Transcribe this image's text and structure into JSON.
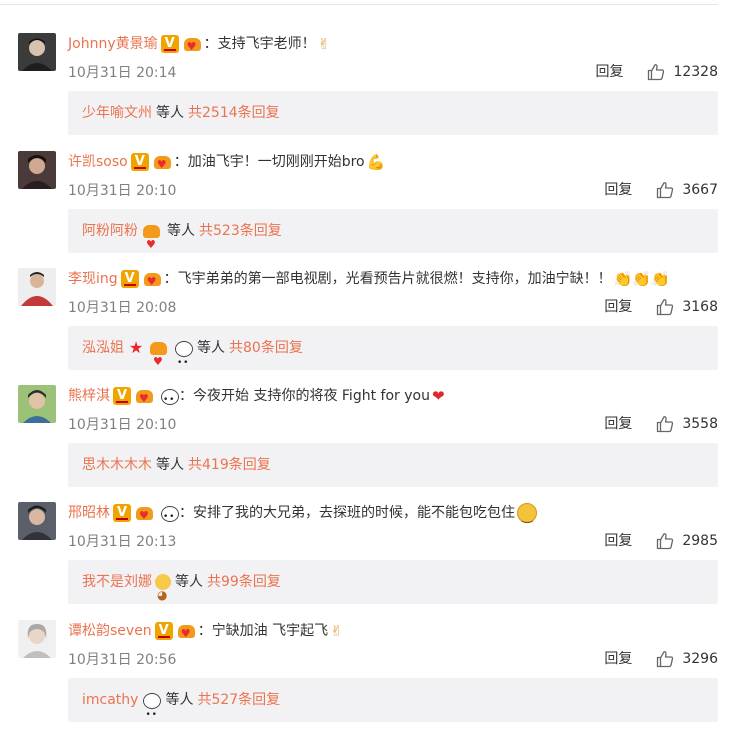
{
  "reply_label": "回复",
  "deng_ren": "等人",
  "comments": [
    {
      "user": "Johnny黄景瑜",
      "text": "支持飞宇老师！",
      "time": "10月31日 20:14",
      "likes": "12328",
      "sub_user": "少年喻文州",
      "sub_total": "共2514条回复",
      "avatar_color": "#3b3b3b",
      "emoji": "hand-icon"
    },
    {
      "user": "许凯soso",
      "text": "加油飞宇！一切刚刚开始bro",
      "time": "10月31日 20:10",
      "likes": "3667",
      "sub_user": "阿粉阿粉",
      "sub_total": "共523条回复",
      "avatar_color": "#4a3a3a",
      "emoji": "muscle-icon"
    },
    {
      "user": "李现ing",
      "text": "飞宇弟弟的第一部电视剧，光看预告片就很燃！支持你，加油宁缺！！",
      "time": "10月31日 20:08",
      "likes": "3168",
      "sub_user": "泓泓姐",
      "sub_total": "共80条回复",
      "avatar_color": "#c23a3a",
      "emoji": "clap-icon"
    },
    {
      "user": "熊梓淇",
      "text": "今夜开始 支持你的将夜 Fight for you",
      "time": "10月31日 20:10",
      "likes": "3558",
      "sub_user": "思木木木木",
      "sub_total": "共419条回复",
      "avatar_color": "#7aa35a",
      "emoji": "heart-icon"
    },
    {
      "user": "邢昭林",
      "text": "安排了我的大兄弟，去探班的时候，能不能包吃包住",
      "time": "10月31日 20:13",
      "likes": "2985",
      "sub_user": "我不是刘娜",
      "sub_total": "共99条回复",
      "avatar_color": "#5a5f6a",
      "emoji": "smile-icon"
    },
    {
      "user": "谭松韵seven",
      "text": "宁缺加油 飞宇起飞",
      "time": "10月31日 20:56",
      "likes": "3296",
      "sub_user": "imcathy",
      "sub_total": "共527条回复",
      "avatar_color": "#c9c9c9",
      "emoji": "victory-hand-icon"
    }
  ]
}
